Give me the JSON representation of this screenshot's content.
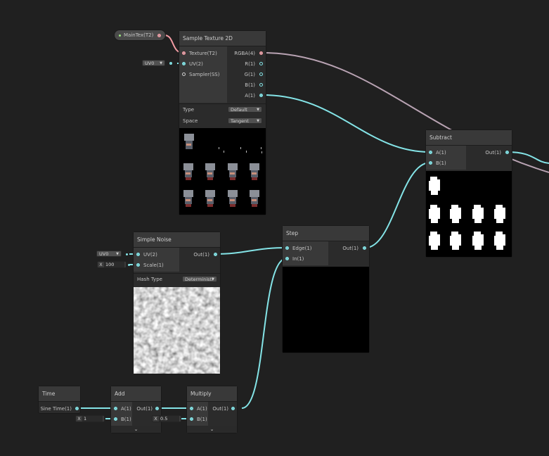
{
  "property_node": {
    "label": "MainTex(T2)"
  },
  "sample_texture": {
    "title": "Sample Texture 2D",
    "inputs": [
      "Texture(T2)",
      "UV(2)",
      "Sampler(SS)"
    ],
    "outputs": [
      "RGBA(4)",
      "R(1)",
      "G(1)",
      "B(1)",
      "A(1)"
    ],
    "uv_dropdown": "UV0",
    "type_label": "Type",
    "type_value": "Default",
    "space_label": "Space",
    "space_value": "Tangent"
  },
  "subtract": {
    "title": "Subtract",
    "inputs": [
      "A(1)",
      "B(1)"
    ],
    "output": "Out(1)"
  },
  "simple_noise": {
    "title": "Simple Noise",
    "inputs": [
      "UV(2)",
      "Scale(1)"
    ],
    "output": "Out(1)",
    "uv_dropdown": "UV0",
    "scale_x": "X",
    "scale_value": "100",
    "hash_label": "Hash Type",
    "hash_value": "Deterministi"
  },
  "step": {
    "title": "Step",
    "inputs": [
      "Edge(1)",
      "In(1)"
    ],
    "output": "Out(1)"
  },
  "time": {
    "title": "Time",
    "output": "Sine Time(1)"
  },
  "add": {
    "title": "Add",
    "inputs": [
      "A(1)",
      "B(1)"
    ],
    "output": "Out(1)",
    "b_x": "X",
    "b_value": "1"
  },
  "multiply": {
    "title": "Multiply",
    "inputs": [
      "A(1)",
      "B(1)"
    ],
    "output": "Out(1)",
    "b_x": "X",
    "b_value": "0.5"
  },
  "colors": {
    "background": "#202020",
    "wire_float": "#84e4e7",
    "wire_texture": "#f39ca4",
    "wire_vector4": "#b9a3b3"
  }
}
